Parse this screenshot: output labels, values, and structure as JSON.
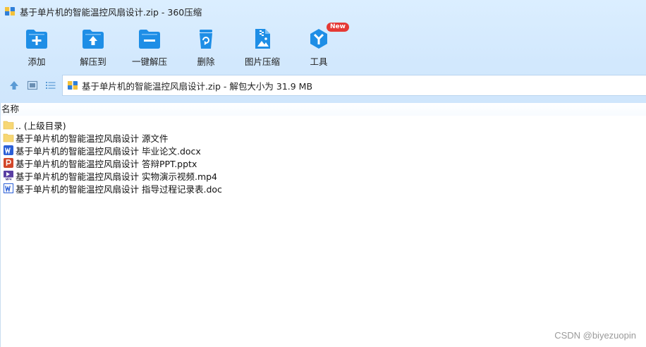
{
  "window": {
    "title": "基于单片机的智能温控风扇设计.zip - 360压缩",
    "icon": "zip-archive-icon"
  },
  "toolbar": {
    "items": [
      {
        "label": "添加",
        "icon": "add-icon"
      },
      {
        "label": "解压到",
        "icon": "extract-to-icon"
      },
      {
        "label": "一键解压",
        "icon": "one-click-extract-icon"
      },
      {
        "label": "删除",
        "icon": "delete-icon"
      },
      {
        "label": "图片压缩",
        "icon": "image-compress-icon"
      },
      {
        "label": "工具",
        "icon": "tools-icon",
        "badge": "New"
      }
    ]
  },
  "navbar": {
    "path": "基于单片机的智能温控风扇设计.zip - 解包大小为 31.9 MB"
  },
  "list": {
    "column_name": "名称",
    "rows": [
      {
        "name": ".. (上级目录)",
        "icon": "parent-folder-icon"
      },
      {
        "name": "基于单片机的智能温控风扇设计 源文件",
        "icon": "folder-icon"
      },
      {
        "name": "基于单片机的智能温控风扇设计 毕业论文.docx",
        "icon": "word-docx-icon"
      },
      {
        "name": "基于单片机的智能温控风扇设计 答辩PPT.pptx",
        "icon": "powerpoint-icon"
      },
      {
        "name": "基于单片机的智能温控风扇设计 实物演示视频.mp4",
        "icon": "mp4-video-icon"
      },
      {
        "name": "基于单片机的智能温控风扇设计 指导过程记录表.doc",
        "icon": "word-doc-icon"
      }
    ]
  },
  "watermark": "CSDN @biyezuopin",
  "colors": {
    "toolbar_bg": "#d2e8fd",
    "icon_blue": "#1e8ee6",
    "badge_red": "#e53935"
  }
}
